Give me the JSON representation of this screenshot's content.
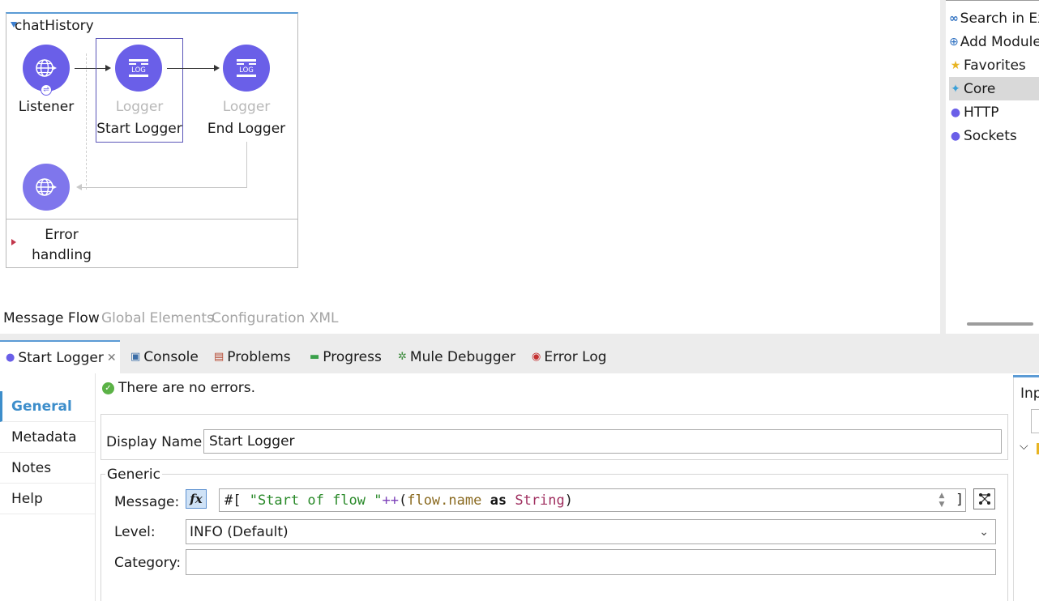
{
  "flow": {
    "name": "chatHistory",
    "nodes": {
      "listener": {
        "label": "Listener"
      },
      "start_logger": {
        "type": "Logger",
        "label": "Start Logger"
      },
      "end_logger": {
        "type": "Logger",
        "label": "End Logger"
      }
    },
    "log_icon_text": "LOG",
    "error_handling": {
      "line1": "Error",
      "line2": "handling"
    }
  },
  "view_tabs": [
    "Message Flow",
    "Global Elements",
    "Configuration XML"
  ],
  "palette": {
    "items": [
      {
        "label": "Search in Exchange",
        "icon": "exchange-icon"
      },
      {
        "label": "Add Modules",
        "icon": "add-icon"
      },
      {
        "label": "Favorites",
        "icon": "star-icon"
      },
      {
        "label": "Core",
        "icon": "core-icon",
        "selected": true
      },
      {
        "label": "HTTP",
        "icon": "module-icon"
      },
      {
        "label": "Sockets",
        "icon": "module-icon"
      }
    ]
  },
  "bottom_tabs": [
    {
      "label": "Start Logger",
      "active": true,
      "closable": true
    },
    {
      "label": "Console"
    },
    {
      "label": "Problems"
    },
    {
      "label": "Progress"
    },
    {
      "label": "Mule Debugger"
    },
    {
      "label": "Error Log"
    }
  ],
  "properties": {
    "sidebar": [
      "General",
      "Metadata",
      "Notes",
      "Help"
    ],
    "status": "There are no errors.",
    "display_name_label": "Display Name:",
    "display_name_value": "Start Logger",
    "generic_title": "Generic",
    "message_label": "Message:",
    "fx_label": "fx",
    "message_expression": {
      "prefix": "#[ ",
      "string": "\"Start of flow \"",
      "op": "++",
      "paren_open": "(",
      "id": "flow.name",
      "kw": "as",
      "type": "String",
      "paren_close": ")",
      "suffix": "]"
    },
    "level_label": "Level:",
    "level_value": "INFO (Default)",
    "category_label": "Category:",
    "category_value": "",
    "right_panel_title": "Inp"
  }
}
